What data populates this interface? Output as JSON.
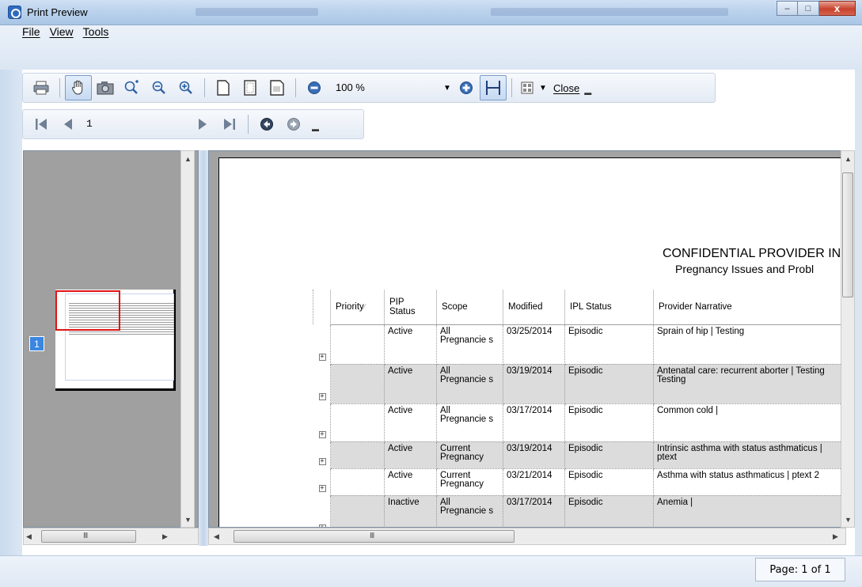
{
  "window": {
    "title": "Print Preview",
    "controls": {
      "minimize": "–",
      "maximize": "□",
      "close": "x"
    }
  },
  "menu": {
    "items": [
      "File",
      "View",
      "Tools"
    ]
  },
  "toolbar": {
    "zoom_value": "100 %",
    "close_label": "Close",
    "icons": [
      "printer-icon",
      "hand-icon",
      "camera-icon",
      "zoom-fit-icon",
      "zoom-out-magnifier-icon",
      "zoom-in-magnifier-icon",
      "page-icon",
      "page-margins-icon",
      "landscape-page-icon",
      "zoom-out-icon",
      "zoom-in-icon",
      "fit-width-icon",
      "multi-page-icon"
    ]
  },
  "navigation": {
    "current_page": "1",
    "icons": [
      "first-page-icon",
      "previous-page-icon",
      "next-page-icon",
      "last-page-icon",
      "back-icon",
      "forward-icon"
    ]
  },
  "thumbnails": {
    "page_badge": "1"
  },
  "document": {
    "title": "CONFIDENTIAL PROVIDER INFOF",
    "subtitle": "Pregnancy Issues and Probl",
    "columns": [
      "Priority",
      "PIP Status",
      "Scope",
      "Modified",
      "IPL Status",
      "Provider Narrative"
    ],
    "rows": [
      {
        "priority": "",
        "pip_status": "Active",
        "scope": "All Pregnancie s",
        "modified": "03/25/2014",
        "ipl_status": "Episodic",
        "narrative": "Sprain of hip | Testing"
      },
      {
        "priority": "",
        "pip_status": "Active",
        "scope": "All Pregnancie s",
        "modified": "03/19/2014",
        "ipl_status": "Episodic",
        "narrative": "Antenatal care: recurrent aborter | Testing Testing"
      },
      {
        "priority": "",
        "pip_status": "Active",
        "scope": "All Pregnancie s",
        "modified": "03/17/2014",
        "ipl_status": "Episodic",
        "narrative": "Common cold |"
      },
      {
        "priority": "",
        "pip_status": "Active",
        "scope": "Current Pregnancy",
        "modified": "03/19/2014",
        "ipl_status": "Episodic",
        "narrative": "Intrinsic asthma with status asthmaticus | ptext"
      },
      {
        "priority": "",
        "pip_status": "Active",
        "scope": "Current Pregnancy",
        "modified": "03/21/2014",
        "ipl_status": "Episodic",
        "narrative": "Asthma with status asthmaticus | ptext 2"
      },
      {
        "priority": "",
        "pip_status": "Inactive",
        "scope": "All Pregnancie s",
        "modified": "03/17/2014",
        "ipl_status": "Episodic",
        "narrative": "Anemia |"
      }
    ],
    "expander_glyph": "+"
  },
  "scroll": {
    "h_grip": "III"
  },
  "status": {
    "page_info": "Page: 1 of 1"
  }
}
